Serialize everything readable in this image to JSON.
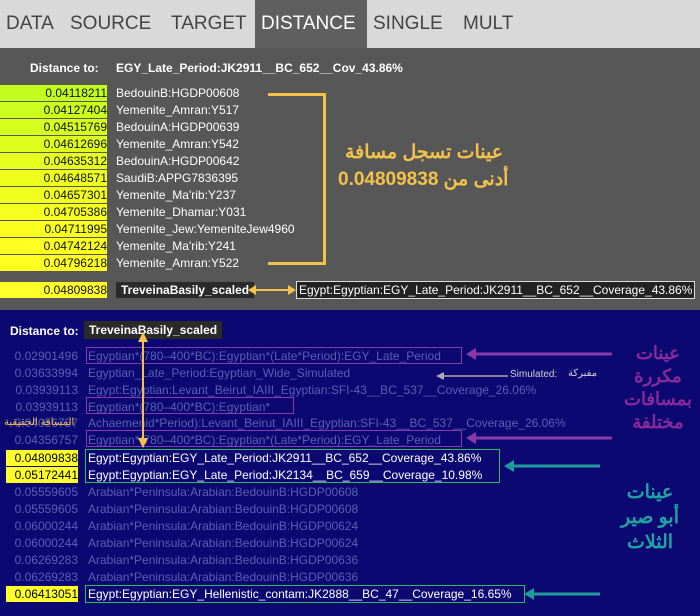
{
  "tabs": [
    "DATA",
    "SOURCE",
    "TARGET",
    "DISTANCE",
    "SINGLE",
    "MULT"
  ],
  "active_tab": "DISTANCE",
  "top": {
    "distance_to_label": "Distance to:",
    "target": "EGY_Late_Period:JK2911__BC_652__Cov_43.86%",
    "rows": [
      {
        "value": "0.04118211",
        "name": "BedouinB:HGDP00608"
      },
      {
        "value": "0.04127404",
        "name": "Yemenite_Amran:Y517"
      },
      {
        "value": "0.04515769",
        "name": "BedouinA:HGDP00639"
      },
      {
        "value": "0.04612696",
        "name": "Yemenite_Amran:Y542"
      },
      {
        "value": "0.04635312",
        "name": "BedouinA:HGDP00642"
      },
      {
        "value": "0.04648571",
        "name": "SaudiB:APPG7836395"
      },
      {
        "value": "0.04657301",
        "name": "Yemenite_Ma'rib:Y237"
      },
      {
        "value": "0.04705386",
        "name": "Yemenite_Dhamar:Y031"
      },
      {
        "value": "0.04711995",
        "name": "Yemenite_Jew:YemeniteJew4960"
      },
      {
        "value": "0.04742124",
        "name": "Yemenite_Ma'rib:Y241"
      },
      {
        "value": "0.04796218",
        "name": "Yemenite_Amran:Y522"
      }
    ],
    "annotation_line1": "عينات تسجل مسافة",
    "annotation_line2": "أدنى من 0.04809838",
    "ref_value": "0.04809838",
    "ref_name": "TreveinaBasily_scaled",
    "ref_target": "Egypt:Egyptian:EGY_Late_Period:JK2911__BC_652__Coverage_43.86%"
  },
  "bottom": {
    "distance_to_label": "Distance to:",
    "target": "TreveinaBasily_scaled",
    "rows": [
      {
        "value": "0.02901496",
        "name": "Egyptian*(780–400*BC):Egyptian*(Late*Period):EGY_Late_Period"
      },
      {
        "value": "0.03633994",
        "name": "Egyptian_Late_Period:Egyptian_Wide_Simulated"
      },
      {
        "value": "0.03939113",
        "name": "Egypt:Egyptian:Levant_Beirut_IAIII_Egyptian:SFI-43__BC_537__Coverage_26.06%"
      },
      {
        "value": "0.03939113",
        "name": "Egyptian*(780–400*BC):Egyptian*"
      },
      {
        "value": "0.04056757",
        "name": "Achaemenid*Period):Levant_Beirut_IAIII_Egyptian:SFI-43__BC_537__Coverage_26.06%"
      },
      {
        "value": "0.04356757",
        "name": "Egyptian*(780–400*BC):Egyptian*(Late*Period):EGY_Late_Period"
      },
      {
        "value": "0.04809838",
        "name": "Egypt:Egyptian:EGY_Late_Period:JK2911__BC_652__Coverage_43.86%"
      },
      {
        "value": "0.05172441",
        "name": "Egypt:Egyptian:EGY_Late_Period:JK2134__BC_659__Coverage_10.98%"
      },
      {
        "value": "0.05559605",
        "name": "Arabian*Peninsula:Arabian:BedouinB:HGDP00608"
      },
      {
        "value": "0.05559605",
        "name": "Arabian*Peninsula:Arabian:BedouinB:HGDP00608"
      },
      {
        "value": "0.06000244",
        "name": "Arabian*Peninsula:Arabian:BedouinB:HGDP00624"
      },
      {
        "value": "0.06000244",
        "name": "Arabian*Peninsula:Arabian:BedouinB:HGDP00624"
      },
      {
        "value": "0.06269283",
        "name": "Arabian*Peninsula:Arabian:BedouinB:HGDP00636"
      },
      {
        "value": "0.06269283",
        "name": "Arabian*Peninsula:Arabian:BedouinB:HGDP00636"
      },
      {
        "value": "0.06413051",
        "name": "Egypt:Egyptian:EGY_Hellenistic_contam:JK2888__BC_47__Coverage_16.65%"
      }
    ],
    "simulated_label": "Simulated:",
    "simulated_ar": "مفبركة",
    "real_distance_ar": "المسافة الحقيقية",
    "repeated_ar": [
      "عينات",
      "مكررة",
      "بمسافات",
      "مختلفة"
    ],
    "abusir_ar": [
      "عينات",
      "أبو صير",
      "الثلاث"
    ]
  },
  "colors": {
    "yellow": "#ffff2a",
    "annot": "#f2c24a",
    "purple": "#8a3aa8",
    "green": "#3aa860",
    "teal": "#1e9a9a"
  }
}
